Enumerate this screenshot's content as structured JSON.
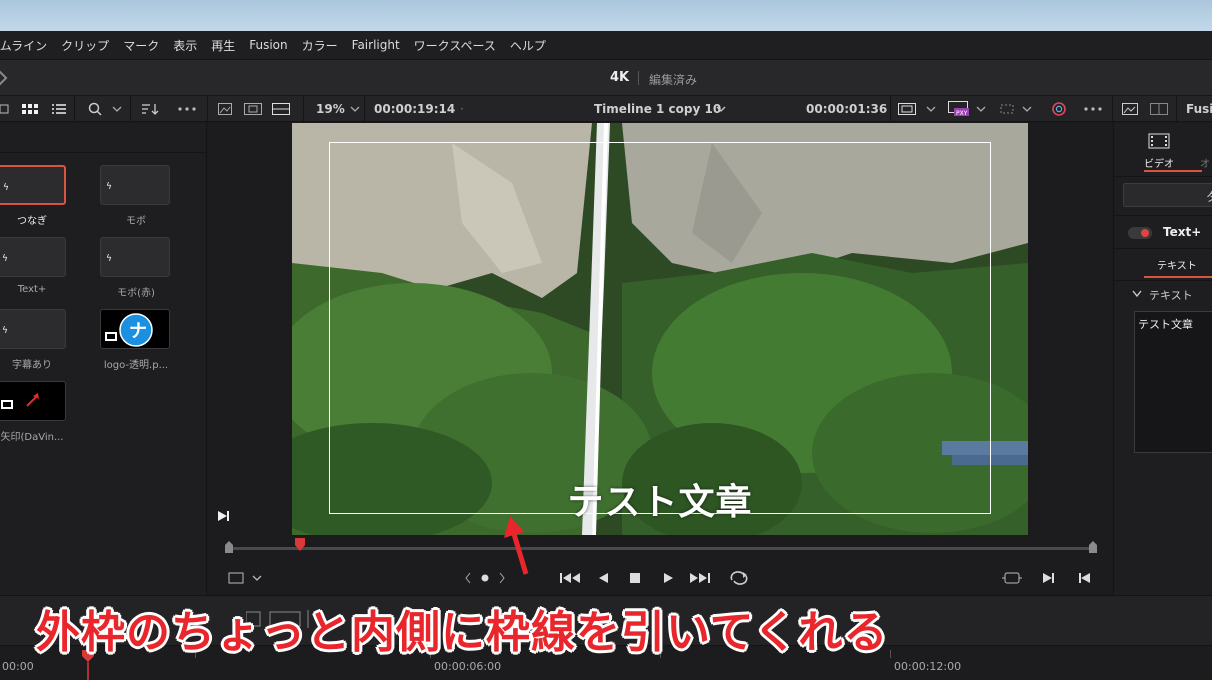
{
  "menu": [
    "イムライン",
    "クリップ",
    "マーク",
    "表示",
    "再生",
    "Fusion",
    "カラー",
    "Fairlight",
    "ワークスペース",
    "ヘルプ"
  ],
  "title": {
    "project": "4K",
    "status": "編集済み"
  },
  "toolbar": {
    "zoom": "19%",
    "timecode_left": "00:00:19:14",
    "timeline_name": "Timeline 1 copy 10",
    "timecode_right": "00:00:01:36",
    "inspector_tab_truncated": "Fusi"
  },
  "media_pool": {
    "clips": [
      {
        "name": "つなぎ",
        "kind": "title",
        "selected": true
      },
      {
        "name": "モボ",
        "kind": "title"
      },
      {
        "name": "Text+",
        "kind": "title"
      },
      {
        "name": "モボ(赤)",
        "kind": "title"
      },
      {
        "name": "字幕あり",
        "kind": "title"
      },
      {
        "name": "logo-透明.p...",
        "kind": "image"
      },
      {
        "name": "矢印(DaVin...",
        "kind": "image"
      }
    ]
  },
  "viewer": {
    "overlay_text": "テスト文章",
    "playhead_fraction": 0.083
  },
  "inspector": {
    "tab_video": "ビデオ",
    "tab_other_truncated": "オ",
    "search_truncated": "タ",
    "effect_name": "Text+",
    "subtab": "テキスト",
    "section": "テキスト",
    "text_value": "テスト文章"
  },
  "timeline_ruler": {
    "ticks": [
      "00:00",
      "00:00:06:00",
      "00:00:12:00"
    ]
  },
  "annotation": {
    "caption": "外枠のちょっと内側に枠線を引いてくれる"
  },
  "colors": {
    "accent_red": "#e8262b",
    "selection_orange": "#d8543f",
    "bg": "#1b1b1d"
  }
}
